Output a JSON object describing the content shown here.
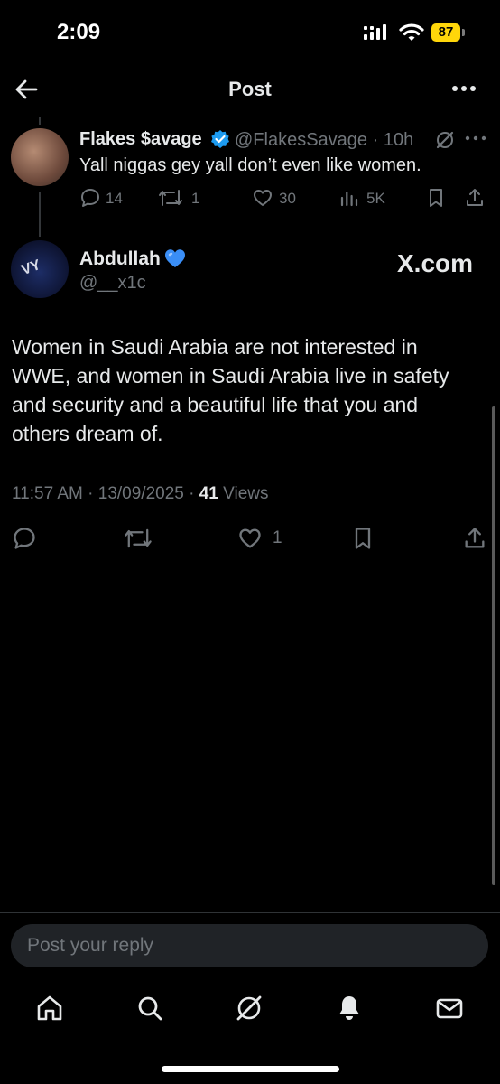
{
  "status_bar": {
    "time": "2:09",
    "battery": "87"
  },
  "header": {
    "title": "Post"
  },
  "reply_tweet": {
    "name": "Flakes $avage",
    "handle": "@FlakesSavage",
    "time": "10h",
    "text": "Yall niggas gey yall don’t even like women.",
    "replies": "14",
    "reposts": "1",
    "likes": "30",
    "views": "5K"
  },
  "main_tweet": {
    "name": "Abdullah",
    "handle": "@__x1c",
    "source_badge": "X.com",
    "text": "Women in Saudi Arabia are not interested in WWE, and women in Saudi Arabia live in safety and security and a beautiful life that you and others dream of.",
    "timestamp": "11:57 AM · 13/09/2025 ·",
    "views_count": "41",
    "views_label": "Views",
    "likes": "1"
  },
  "reply_input": {
    "placeholder": "Post your reply"
  },
  "nav": {
    "items": [
      "home-icon",
      "search-icon",
      "grok-icon",
      "notifications-icon",
      "messages-icon"
    ]
  },
  "colors": {
    "background": "#000000",
    "text": "#e7e9ea",
    "muted": "#71767b",
    "verified": "#1d9bf0",
    "battery": "#ffd60a"
  }
}
